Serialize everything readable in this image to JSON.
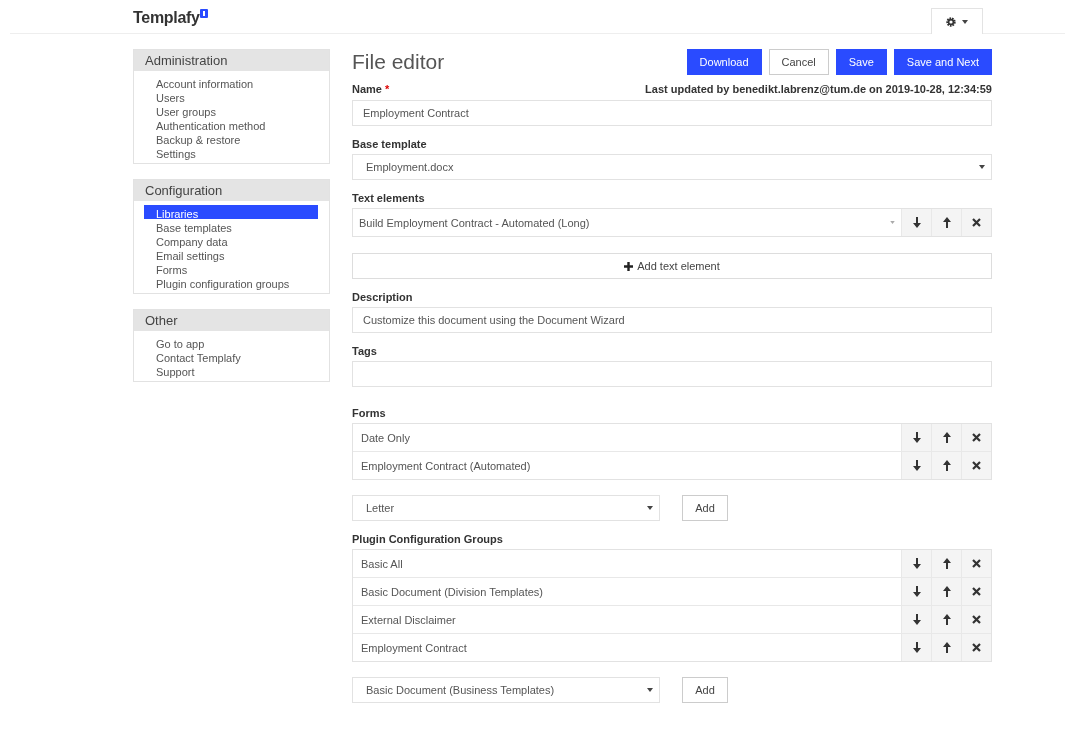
{
  "header": {
    "logo": "Templafy"
  },
  "sidebar": [
    {
      "title": "Administration",
      "items": [
        {
          "label": "Account information",
          "selected": false
        },
        {
          "label": "Users",
          "selected": false
        },
        {
          "label": "User groups",
          "selected": false
        },
        {
          "label": "Authentication method",
          "selected": false
        },
        {
          "label": "Backup & restore",
          "selected": false
        },
        {
          "label": "Settings",
          "selected": false
        }
      ]
    },
    {
      "title": "Configuration",
      "items": [
        {
          "label": "Libraries",
          "selected": true
        },
        {
          "label": "Base templates",
          "selected": false
        },
        {
          "label": "Company data",
          "selected": false
        },
        {
          "label": "Email settings",
          "selected": false
        },
        {
          "label": "Forms",
          "selected": false
        },
        {
          "label": "Plugin configuration groups",
          "selected": false
        }
      ]
    },
    {
      "title": "Other",
      "items": [
        {
          "label": "Go to app",
          "selected": false
        },
        {
          "label": "Contact Templafy",
          "selected": false
        },
        {
          "label": "Support",
          "selected": false
        }
      ]
    }
  ],
  "editor": {
    "title": "File editor",
    "buttons": [
      {
        "label": "Download",
        "kind": "primary"
      },
      {
        "label": "Cancel",
        "kind": "default"
      },
      {
        "label": "Save",
        "kind": "primary"
      },
      {
        "label": "Save and Next",
        "kind": "primary"
      }
    ],
    "name_label": "Name",
    "required_mark": "*",
    "last_updated": "Last updated by benedikt.labrenz@tum.de on 2019-10-28, 12:34:59",
    "name_value": "Employment Contract",
    "base_template_label": "Base template",
    "base_template_value": "Employment.docx",
    "text_elements_label": "Text elements",
    "text_element_value": "Build Employment Contract - Automated (Long)",
    "add_text_element": "Add text element",
    "description_label": "Description",
    "description_value": "Customize this document using the Document Wizard",
    "tags_label": "Tags",
    "forms_label": "Forms",
    "forms": [
      "Date Only",
      "Employment Contract (Automated)"
    ],
    "forms_select": "Letter",
    "forms_add": "Add",
    "plugins_label": "Plugin Configuration Groups",
    "plugins": [
      "Basic All",
      "Basic Document (Division Templates)",
      "External Disclaimer",
      "Employment Contract"
    ],
    "plugins_select": "Basic Document (Business Templates)",
    "plugins_add": "Add"
  }
}
